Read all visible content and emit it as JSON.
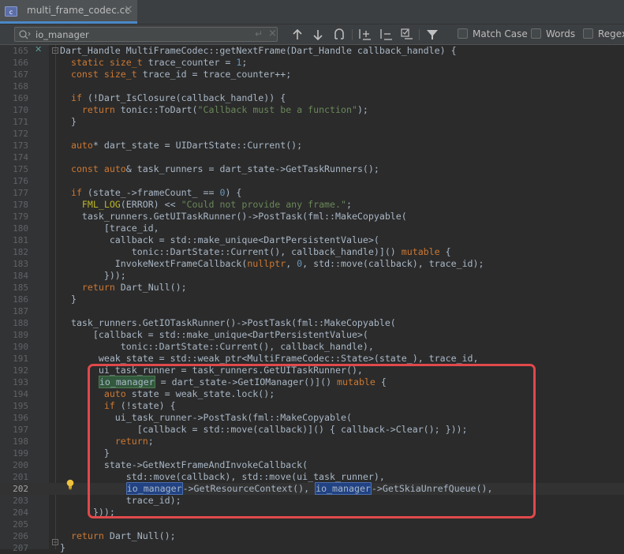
{
  "tab": {
    "filename": "multi_frame_codec.cc",
    "close": "×"
  },
  "find": {
    "query": "io_manager",
    "enter_glyph": "↵",
    "clear_glyph": "×",
    "options": [
      "Match Case",
      "Words",
      "Regex"
    ]
  },
  "gutter_mark": "✕",
  "lines": [
    {
      "n": "165",
      "t": "Dart_Handle MultiFrameCodec::getNextFrame(Dart_Handle callback_handle) {"
    },
    {
      "n": "166",
      "t": "  static size_t trace_counter = 1;"
    },
    {
      "n": "167",
      "t": "  const size_t trace_id = trace_counter++;"
    },
    {
      "n": "168",
      "t": ""
    },
    {
      "n": "169",
      "t": "  if (!Dart_IsClosure(callback_handle)) {"
    },
    {
      "n": "170",
      "t": "    return tonic::ToDart(\"Callback must be a function\");"
    },
    {
      "n": "171",
      "t": "  }"
    },
    {
      "n": "172",
      "t": ""
    },
    {
      "n": "173",
      "t": "  auto* dart_state = UIDartState::Current();"
    },
    {
      "n": "174",
      "t": ""
    },
    {
      "n": "175",
      "t": "  const auto& task_runners = dart_state->GetTaskRunners();"
    },
    {
      "n": "176",
      "t": ""
    },
    {
      "n": "177",
      "t": "  if (state_->frameCount_ == 0) {"
    },
    {
      "n": "178",
      "t": "    FML_LOG(ERROR) << \"Could not provide any frame.\";"
    },
    {
      "n": "179",
      "t": "    task_runners.GetUITaskRunner()->PostTask(fml::MakeCopyable("
    },
    {
      "n": "180",
      "t": "        [trace_id,"
    },
    {
      "n": "181",
      "t": "         callback = std::make_unique<DartPersistentValue>("
    },
    {
      "n": "182",
      "t": "             tonic::DartState::Current(), callback_handle)]() mutable {"
    },
    {
      "n": "183",
      "t": "          InvokeNextFrameCallback(nullptr, 0, std::move(callback), trace_id);"
    },
    {
      "n": "184",
      "t": "        }));"
    },
    {
      "n": "185",
      "t": "    return Dart_Null();"
    },
    {
      "n": "186",
      "t": "  }"
    },
    {
      "n": "187",
      "t": ""
    },
    {
      "n": "188",
      "t": "  task_runners.GetIOTaskRunner()->PostTask(fml::MakeCopyable("
    },
    {
      "n": "189",
      "t": "      [callback = std::make_unique<DartPersistentValue>("
    },
    {
      "n": "190",
      "t": "           tonic::DartState::Current(), callback_handle),"
    },
    {
      "n": "191",
      "t": "       weak_state = std::weak_ptr<MultiFrameCodec::State>(state_), trace_id,"
    },
    {
      "n": "192",
      "t": "       ui_task_runner = task_runners.GetUITaskRunner(),"
    },
    {
      "n": "193",
      "t": "       io_manager = dart_state->GetIOManager()]() mutable {"
    },
    {
      "n": "194",
      "t": "        auto state = weak_state.lock();"
    },
    {
      "n": "195",
      "t": "        if (!state) {"
    },
    {
      "n": "196",
      "t": "          ui_task_runner->PostTask(fml::MakeCopyable("
    },
    {
      "n": "197",
      "t": "              [callback = std::move(callback)]() { callback->Clear(); }));"
    },
    {
      "n": "198",
      "t": "          return;"
    },
    {
      "n": "199",
      "t": "        }"
    },
    {
      "n": "200",
      "t": "        state->GetNextFrameAndInvokeCallback("
    },
    {
      "n": "201",
      "t": "            std::move(callback), std::move(ui_task_runner),"
    },
    {
      "n": "202",
      "t": "            io_manager->GetResourceContext(), io_manager->GetSkiaUnrefQueue(),"
    },
    {
      "n": "203",
      "t": "            trace_id);"
    },
    {
      "n": "204",
      "t": "      }));"
    },
    {
      "n": "205",
      "t": ""
    },
    {
      "n": "206",
      "t": "  return Dart_Null();"
    },
    {
      "n": "207",
      "t": "}"
    }
  ],
  "colors": {
    "keyword": "#cc7832",
    "number": "#6897bb",
    "string": "#6a8759",
    "highlight_box": "#e0494b",
    "match_green": "#32593d",
    "match_selected": "#214283"
  }
}
